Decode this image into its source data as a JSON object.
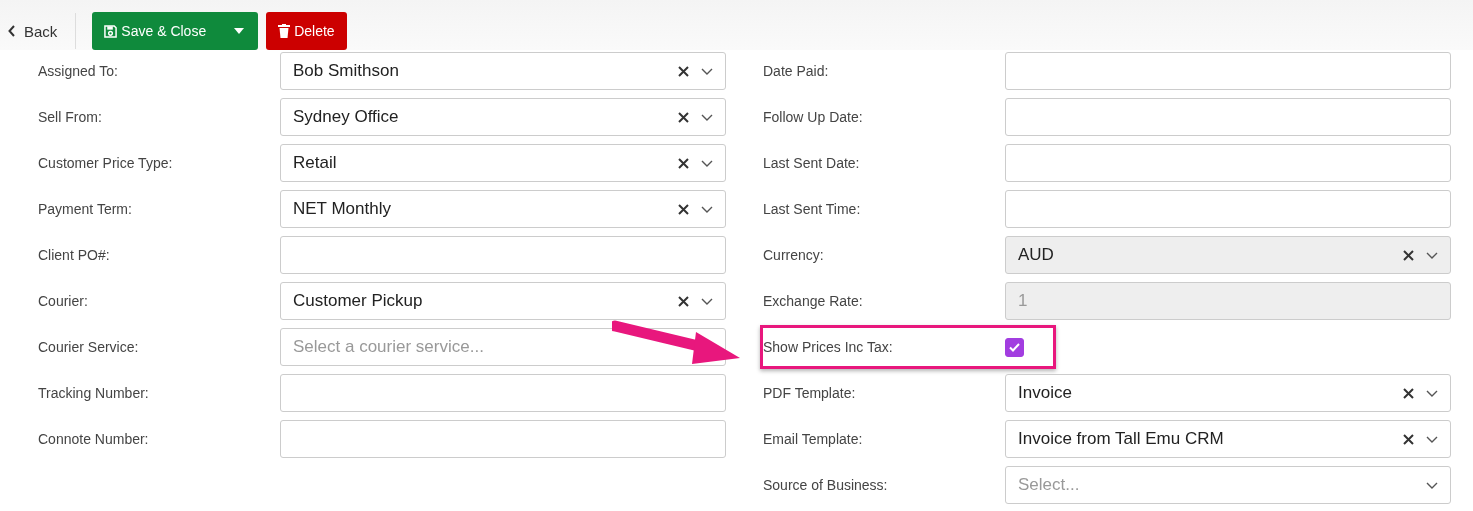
{
  "toolbar": {
    "back": "Back",
    "save": "Save & Close",
    "delete": "Delete"
  },
  "left_fields": [
    {
      "label": "Assigned To:",
      "kind": "select",
      "value": "Bob Smithson",
      "clearable": true
    },
    {
      "label": "Sell From:",
      "kind": "select",
      "value": "Sydney Office",
      "clearable": true
    },
    {
      "label": "Customer Price Type:",
      "kind": "select",
      "value": "Retail",
      "clearable": true
    },
    {
      "label": "Payment Term:",
      "kind": "select",
      "value": "NET Monthly",
      "clearable": true
    },
    {
      "label": "Client PO#:",
      "kind": "text"
    },
    {
      "label": "Courier:",
      "kind": "select",
      "value": "Customer Pickup",
      "clearable": true
    },
    {
      "label": "Courier Service:",
      "kind": "select",
      "placeholder": "Select a courier service...",
      "clearable": false
    },
    {
      "label": "Tracking Number:",
      "kind": "text"
    },
    {
      "label": "Connote Number:",
      "kind": "text"
    }
  ],
  "right_fields": [
    {
      "label": "Date Paid:",
      "kind": "text"
    },
    {
      "label": "Follow Up Date:",
      "kind": "text"
    },
    {
      "label": "Last Sent Date:",
      "kind": "text"
    },
    {
      "label": "Last Sent Time:",
      "kind": "text"
    },
    {
      "label": "Currency:",
      "kind": "select",
      "value": "AUD",
      "clearable": true,
      "disabled": true
    },
    {
      "label": "Exchange Rate:",
      "kind": "text",
      "value": "1",
      "disabled": true
    },
    {
      "label": "Show Prices Inc Tax:",
      "kind": "checkbox",
      "checked": true,
      "highlighted": true
    },
    {
      "label": "PDF Template:",
      "kind": "select",
      "value": "Invoice",
      "clearable": true
    },
    {
      "label": "Email Template:",
      "kind": "select",
      "value": "Invoice from Tall Emu CRM",
      "clearable": true
    },
    {
      "label": "Source of Business:",
      "kind": "select",
      "placeholder": "Select...",
      "clearable": false
    }
  ]
}
